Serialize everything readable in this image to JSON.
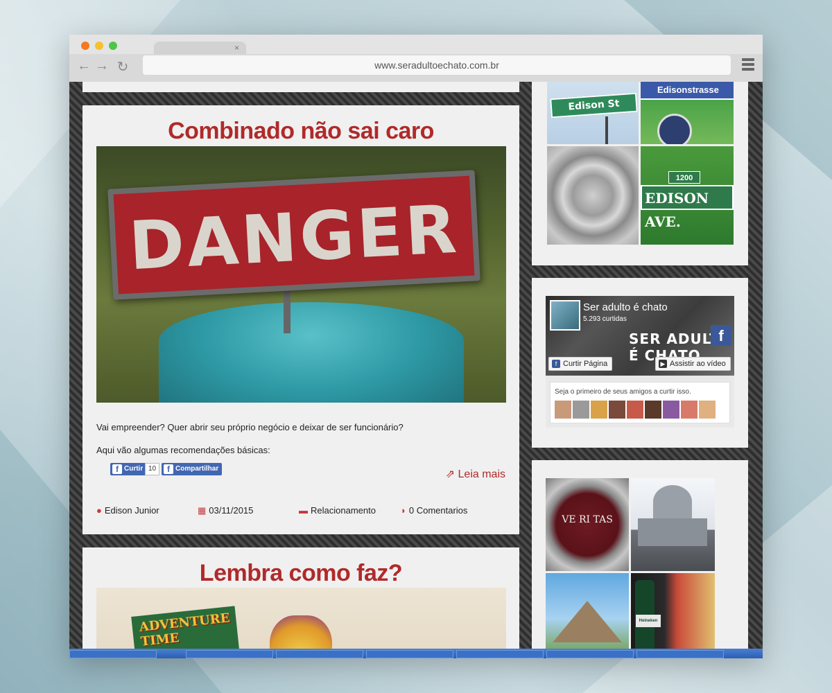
{
  "browser": {
    "url": "www.seradultoechato.com.br",
    "tab_close": "×",
    "icons": [
      "back-arrow-icon",
      "forward-arrow-icon",
      "reload-icon",
      "hamburger-menu-icon"
    ]
  },
  "posts": [
    {
      "title": "Combinado não sai caro",
      "hero_text": "DANGER",
      "excerpt_lines": [
        "Vai empreender? Quer abrir seu próprio negócio e deixar de ser funcionário?",
        "Aqui vão algumas recomendações básicas:"
      ],
      "social": {
        "like_label": "Curtir",
        "like_count": "10",
        "share_label": "Compartilhar"
      },
      "read_more": "Leia mais",
      "meta": {
        "author": "Edison Junior",
        "date": "03/11/2015",
        "category": "Relacionamento",
        "comments": "0 Comentarios"
      }
    },
    {
      "title": "Lembra como faz?",
      "hero_text": "ADVENTURE TIME"
    }
  ],
  "sidebar": {
    "edison_tiles": {
      "edison_st": "Edison St",
      "edisonstrasse": "Edisonstrasse",
      "ave_number": "1200",
      "edison_ave": "EDISON AVE."
    },
    "facebook_widget": {
      "page_name": "Ser adulto é chato",
      "likes": "5.293 curtidas",
      "cover_text": "SER ADULTO É CHATO",
      "curtir_button": "Curtir Página",
      "video_button": "Assistir ao vídeo",
      "friends_text": "Seja o primeiro de seus amigos a curtir isso."
    },
    "gallery": {
      "veritas": "VE RI TAS",
      "beer_label": "Heineken"
    }
  },
  "status_bar": {
    "url": "nado-nao-sai-caro"
  },
  "colors": {
    "title_red": "#b02a2a",
    "facebook_blue": "#4267b2"
  }
}
